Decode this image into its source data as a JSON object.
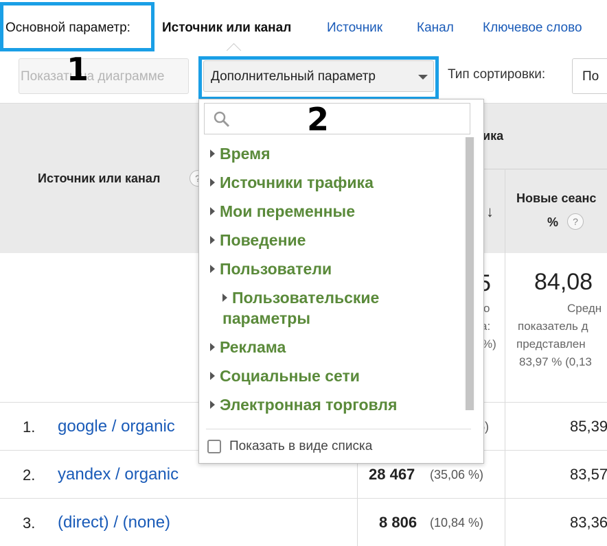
{
  "tabs": {
    "primary_label": "Основной параметр:",
    "active": "Источник или канал",
    "links": [
      "Источник",
      "Канал",
      "Ключевое слово"
    ]
  },
  "annotations": {
    "one": "1",
    "two": "2"
  },
  "toolbar": {
    "plot_button": "Показать на диаграмме",
    "secondary_dimension": "Дополнительный параметр",
    "sort_label": "Тип сортировки:",
    "sort_value": "По"
  },
  "table": {
    "headers": {
      "source": "Источник или канал",
      "acquisition_partial": "ика",
      "new_sessions": "Новые сеанс",
      "new_sessions_unit": "%"
    },
    "summary": {
      "col2_fragments": [
        "5",
        "о",
        "а:",
        "%)"
      ],
      "new_sessions_value": "84,08",
      "new_sessions_sub": [
        "Средн",
        "показатель д",
        "представлен",
        "83,97 % (0,13"
      ]
    },
    "rows": [
      {
        "num": "1.",
        "name": "google / organic",
        "value": "",
        "pct": "%)",
        "right": "85,39"
      },
      {
        "num": "2.",
        "name": "yandex / organic",
        "value": "28 467",
        "pct": "(35,06 %)",
        "right": "83,57"
      },
      {
        "num": "3.",
        "name": "(direct) / (none)",
        "value": "8 806",
        "pct": "(10,84 %)",
        "right": "83,36"
      }
    ]
  },
  "dropdown": {
    "search_placeholder": "",
    "categories": [
      "Время",
      "Источники трафика",
      "Мои переменные",
      "Поведение",
      "Пользователи",
      "Пользовательские параметры",
      "Реклама",
      "Социальные сети",
      "Электронная торговля"
    ],
    "list_view_label": "Показать в виде списка"
  },
  "colors": {
    "highlight": "#1a9fe6",
    "link": "#1a5bb8",
    "category": "#5a8a3a"
  },
  "icons": [
    "search-icon",
    "expand-triangle-icon",
    "sort-arrow-down-icon",
    "help-icon",
    "dropdown-caret-icon"
  ]
}
